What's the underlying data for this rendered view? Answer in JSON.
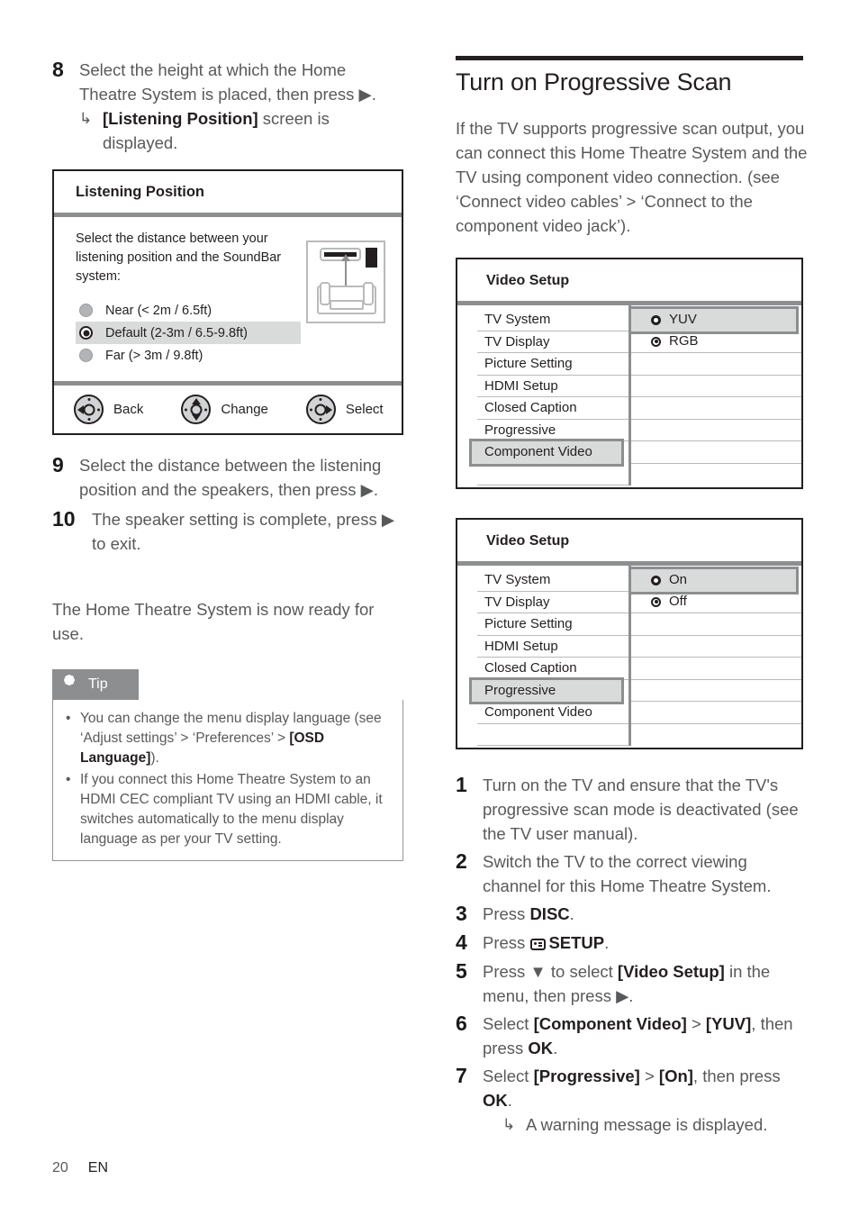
{
  "left_column": {
    "step8": {
      "number": "8",
      "text_before": "Select the height at which the Home Theatre System is placed, then press ",
      "arrow": "▶",
      "text_after": ".",
      "substep_hook": "↳",
      "substep_bold": "[Listening Position]",
      "substep_rest": " screen is displayed."
    },
    "listening_position_dialog": {
      "title": "Listening Position",
      "description": "Select the distance between your listening position and the SoundBar system:",
      "options": [
        {
          "label": "Near (< 2m / 6.5ft)",
          "selected": false
        },
        {
          "label": "Default (2-3m / 6.5-9.8ft)",
          "selected": true
        },
        {
          "label": "Far (> 3m / 9.8ft)",
          "selected": false
        }
      ],
      "footer_buttons": [
        {
          "label": "Back",
          "direction": "left"
        },
        {
          "label": "Change",
          "direction": "updown"
        },
        {
          "label": "Select",
          "direction": "right"
        }
      ]
    },
    "step9": {
      "number": "9",
      "text_before": "Select the distance between the listening position and the speakers, then press ",
      "arrow": "▶",
      "text_after": "."
    },
    "step10": {
      "number": "10",
      "text_before": "The speaker setting is complete, press ",
      "arrow": "▶",
      "text_after": " to exit."
    },
    "closing_paragraph": "The Home Theatre System is now ready for use.",
    "tip_box": {
      "heading": "Tip",
      "icon": "asterisk-icon",
      "bullet": "•",
      "items": [
        {
          "part1": "You can change the menu display language (see ‘Adjust settings’ > ‘Preferences’ > ",
          "bold": "[OSD Language]",
          "part2": ")."
        },
        {
          "part1": "If you connect this Home Theatre System to an HDMI CEC compliant TV using an HDMI cable, it switches automatically to the menu display language as per your TV setting.",
          "bold": "",
          "part2": ""
        }
      ]
    }
  },
  "right_column": {
    "section_title": "Turn on Progressive Scan",
    "intro_paragraph": "If the TV supports progressive scan output, you can connect this Home Theatre System and the TV using component video connection. (see ‘Connect video cables’ > ‘Connect to the component video jack’).",
    "video_setup_dialog_1": {
      "title": "Video Setup",
      "menu_items": [
        {
          "label": "TV System",
          "selected": false
        },
        {
          "label": "TV Display",
          "selected": false
        },
        {
          "label": "Picture Setting",
          "selected": false
        },
        {
          "label": "HDMI Setup",
          "selected": false
        },
        {
          "label": "Closed Caption",
          "selected": false
        },
        {
          "label": "Progressive",
          "selected": false
        },
        {
          "label": "Component Video",
          "selected": true
        }
      ],
      "options": [
        {
          "label": "YUV",
          "selected": true,
          "radio": "hollow"
        },
        {
          "label": "RGB",
          "selected": false,
          "radio": "filled"
        }
      ]
    },
    "video_setup_dialog_2": {
      "title": "Video Setup",
      "menu_items": [
        {
          "label": "TV System",
          "selected": false
        },
        {
          "label": "TV Display",
          "selected": false
        },
        {
          "label": "Picture Setting",
          "selected": false
        },
        {
          "label": "HDMI Setup",
          "selected": false
        },
        {
          "label": "Closed Caption",
          "selected": false
        },
        {
          "label": "Progressive",
          "selected": true
        },
        {
          "label": "Component Video",
          "selected": false
        }
      ],
      "options": [
        {
          "label": "On",
          "selected": true,
          "radio": "hollow"
        },
        {
          "label": "Off",
          "selected": false,
          "radio": "filled"
        }
      ]
    },
    "steps": [
      {
        "number": "1",
        "text": "Turn on the TV and ensure that the TV's progressive scan mode is deactivated (see the TV user manual)."
      },
      {
        "number": "2",
        "text": "Switch the TV to the correct viewing channel for this Home Theatre System."
      },
      {
        "number": "3",
        "text": "Press ",
        "bold": "DISC",
        "tail": "."
      },
      {
        "number": "4",
        "text": "Press ",
        "glyph": "setup-icon",
        "bold": "SETUP",
        "tail": "."
      },
      {
        "number": "5",
        "text": "Press ▼ to select ",
        "bold": "[Video Setup]",
        "tail": " in the menu, then press ▶."
      },
      {
        "number": "6",
        "text": "Select ",
        "bold": "[Component Video]",
        "mid": " > ",
        "bold2": "[YUV]",
        "tail": ", then press ",
        "bold3": "OK",
        "tail2": "."
      },
      {
        "number": "7",
        "text": "Select ",
        "bold": "[Progressive]",
        "mid": " > ",
        "bold2": "[On]",
        "tail": ", then press ",
        "bold3": "OK",
        "tail2": ".",
        "substep_hook": "↳",
        "substep": "A warning message is displayed."
      }
    ]
  },
  "footer": {
    "page_number": "20",
    "language_code": "EN"
  },
  "colors": {
    "body_text": "#58595b",
    "heading_text": "#231f20",
    "rule_dark": "#231f20",
    "rule_gray": "#8d8e90",
    "selection_gray": "#d9dada",
    "tip_header_bg": "#8d8e90"
  }
}
